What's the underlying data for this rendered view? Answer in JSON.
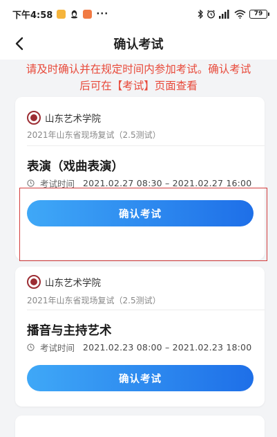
{
  "status_bar": {
    "time": "下午4:58",
    "more": "···",
    "battery": "79"
  },
  "nav": {
    "title": "确认考试",
    "back_icon": "chevron-left-icon"
  },
  "notice": {
    "line1": "请及时确认并在规定时间内参加考试。确认考试",
    "line2": "后可在【考试】页面查看"
  },
  "exams": [
    {
      "school": "山东艺术学院",
      "subtitle": "2021年山东省现场复试（2.5测试）",
      "subject": "表演（戏曲表演）",
      "time_label": "考试时间",
      "time_value": "2021.02.27 08:30 – 2021.02.27 16:00",
      "button": "确认考试"
    },
    {
      "school": "山东艺术学院",
      "subtitle": "2021年山东省现场复试（2.5测试）",
      "subject": "播音与主持艺术",
      "time_label": "考试时间",
      "time_value": "2021.02.23 08:00 – 2021.02.23 18:00",
      "button": "确认考试"
    }
  ],
  "colors": {
    "notice": "#e84a3b",
    "button_start": "#3fa8f7",
    "button_end": "#1e6fe8",
    "highlight": "#d23a3a",
    "school_logo": "#9c2d33"
  }
}
